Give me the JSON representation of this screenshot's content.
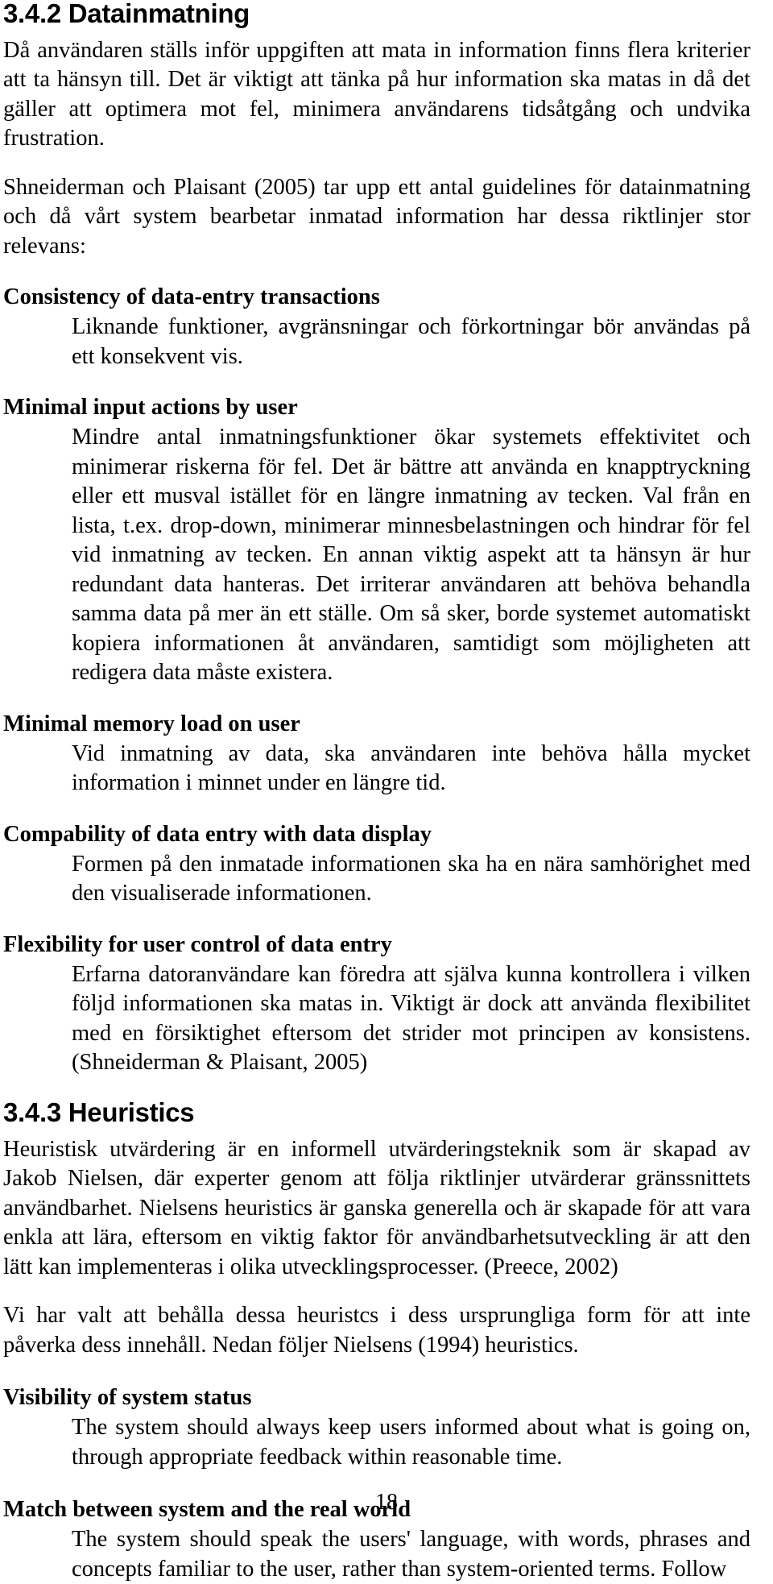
{
  "document": {
    "page_number": "18",
    "sections": [
      {
        "id": "3-4-2",
        "heading": "3.4.2 Datainmatning",
        "paragraphs": [
          "Då användaren ställs inför uppgiften att mata in information finns flera kriterier att ta hänsyn till. Det är viktigt att tänka på hur information ska matas in då det gäller att optimera mot fel, minimera användarens tidsåtgång och undvika frustration.",
          "Shneiderman och Plaisant (2005) tar upp ett antal guidelines för datainmatning och då vårt system bearbetar inmatad information har dessa riktlinjer stor relevans:"
        ],
        "guidelines": [
          {
            "title": "Consistency of data-entry transactions",
            "body": "Liknande funktioner, avgränsningar och förkortningar bör användas på ett konsekvent vis."
          },
          {
            "title": "Minimal input actions by user",
            "body": "Mindre antal inmatningsfunktioner ökar systemets effektivitet och minimerar riskerna för fel. Det är bättre att använda en knapptryckning eller ett musval istället för en längre inmatning av tecken. Val från en lista, t.ex. drop-down, minimerar minnesbelastningen och hindrar för fel vid inmatning av tecken. En annan viktig aspekt att ta hänsyn är hur redundant data hanteras. Det irriterar användaren att behöva behandla samma data på mer än ett ställe. Om så sker, borde systemet automatiskt kopiera informationen åt användaren, samtidigt som möjligheten att redigera data måste existera."
          },
          {
            "title": "Minimal memory load on user",
            "body": "Vid inmatning av data, ska användaren inte behöva hålla mycket information i minnet under en längre tid."
          },
          {
            "title": "Compability of data entry with data display",
            "body": "Formen på den inmatade informationen ska ha en nära samhörighet med den visualiserade informationen."
          },
          {
            "title": "Flexibility for user control of data entry",
            "body": "Erfarna datoranvändare kan föredra att själva kunna kontrollera i vilken följd informationen ska matas in. Viktigt är dock att använda flexibilitet med en försiktighet eftersom det strider mot principen av konsistens. (Shneiderman & Plaisant, 2005)"
          }
        ]
      },
      {
        "id": "3-4-3",
        "heading": "3.4.3 Heuristics",
        "paragraphs": [
          "Heuristisk utvärdering är en informell utvärderingsteknik som är skapad av Jakob Nielsen, där experter genom att följa riktlinjer utvärderar gränssnittets användbarhet. Nielsens heuristics är ganska generella och är skapade för att vara enkla att lära, eftersom en viktig faktor för användbarhetsutveckling är att den lätt kan implementeras i olika utvecklingsprocesser. (Preece, 2002)",
          "Vi har valt att behålla dessa heuristcs i dess ursprungliga form för att inte påverka dess innehåll. Nedan följer Nielsens (1994) heuristics."
        ],
        "heuristics": [
          {
            "title": "Visibility of system status",
            "body": "The system should always keep users informed about what is going on, through appropriate feedback within reasonable time."
          },
          {
            "title": "Match between system and the real world",
            "body": "The system should speak the users' language, with words, phrases and concepts familiar to the user, rather than system-oriented terms. Follow"
          }
        ]
      }
    ]
  }
}
